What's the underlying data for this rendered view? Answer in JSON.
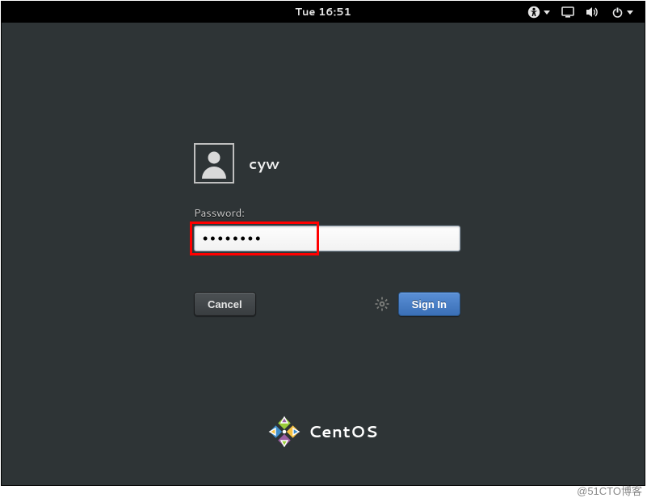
{
  "topbar": {
    "clock": "Tue 16:51"
  },
  "login": {
    "username": "cyw",
    "password_label": "Password:",
    "password_value": "••••••••",
    "cancel_label": "Cancel",
    "signin_label": "Sign In"
  },
  "footer": {
    "distro": "CentOS"
  },
  "watermark": "@51CTO博客",
  "icons": {
    "accessibility": "accessibility-icon",
    "screen": "screen-icon",
    "volume": "volume-icon",
    "power": "power-icon",
    "avatar": "avatar-icon",
    "gear": "gear-icon",
    "centos": "centos-logo-icon"
  },
  "colors": {
    "background": "#2e3436",
    "topbar": "#000000",
    "signin_bg": "#4a7fc6",
    "highlight": "#ff0000"
  }
}
